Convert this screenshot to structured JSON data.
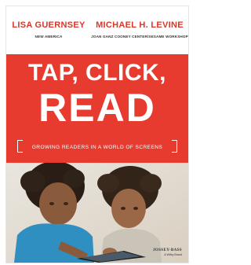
{
  "authors": [
    {
      "name": "LISA GUERNSEY",
      "affiliation": "NEW AMERICA"
    },
    {
      "name": "MICHAEL H. LEVINE",
      "affiliation": "JOAN GANZ COONEY CENTER/SESAME WORKSHOP"
    }
  ],
  "title": {
    "line1": "TAP, CLICK,",
    "line2": "READ"
  },
  "subtitle": "GROWING READERS IN A WORLD OF SCREENS",
  "publisher": {
    "name": "JOSSEY-BASS",
    "sub": "A Wiley Brand"
  },
  "colors": {
    "banner": "#e63b2e",
    "author_text": "#d9362a",
    "title_text": "#ffffff"
  }
}
